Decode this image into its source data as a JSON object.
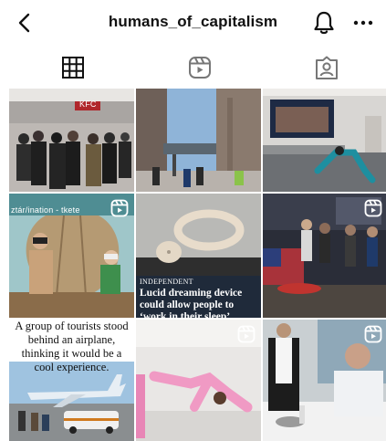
{
  "header": {
    "title": "humans_of_capitalism",
    "back_icon": "chevron-left-icon",
    "bell_icon": "bell-icon",
    "more_icon": "ellipsis-icon"
  },
  "tabs": [
    {
      "name": "grid",
      "icon": "grid-icon",
      "active": true
    },
    {
      "name": "reels",
      "icon": "reels-icon",
      "active": false
    },
    {
      "name": "tagged",
      "icon": "tagged-person-icon",
      "active": false
    }
  ],
  "posts": [
    {
      "id": 1,
      "type": "photo",
      "alt_scene": "crowd in mall",
      "sign": "KFC"
    },
    {
      "id": 2,
      "type": "photo",
      "alt_scene": "city street bus stop"
    },
    {
      "id": 3,
      "type": "photo",
      "alt_scene": "office stretching"
    },
    {
      "id": 4,
      "type": "reel",
      "alt_scene": "VR hot air balloon",
      "sign_text": "ztár/ination - tkete"
    },
    {
      "id": 5,
      "type": "photo",
      "source": "INDEPENDENT",
      "headline": "Lucid dreaming device could allow people to ‘work in their sleep’"
    },
    {
      "id": 6,
      "type": "reel",
      "alt_scene": "night party flag"
    },
    {
      "id": 7,
      "type": "photo",
      "caption": "A group of tourists stood behind an airplane, thinking it would be a cool experience."
    },
    {
      "id": 8,
      "type": "reel",
      "alt_scene": "pink suit split"
    },
    {
      "id": 9,
      "type": "reel",
      "alt_scene": "restaurant waiter"
    }
  ],
  "colors": {
    "text": "#111111",
    "background": "#ffffff"
  }
}
